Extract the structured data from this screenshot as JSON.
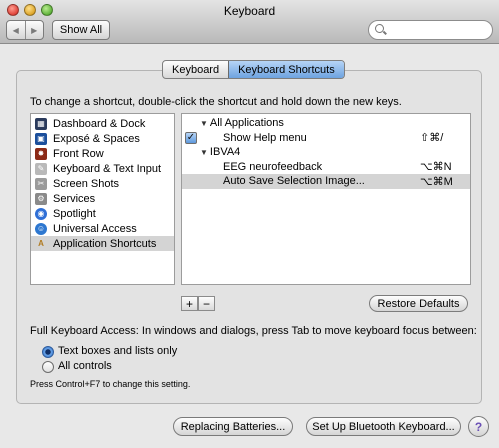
{
  "window": {
    "title": "Keyboard"
  },
  "toolbar": {
    "back_glyph": "◀",
    "forward_glyph": "▶",
    "show_all": "Show All",
    "search_placeholder": ""
  },
  "tabs": [
    {
      "label": "Keyboard",
      "selected": false
    },
    {
      "label": "Keyboard Shortcuts",
      "selected": true
    }
  ],
  "instructions": "To change a shortcut, double-click the shortcut and hold down the new keys.",
  "categories": [
    {
      "label": "Dashboard & Dock",
      "icon": "dashboard-dock-icon",
      "color": "#2a3a5c",
      "glyph": "▦"
    },
    {
      "label": "Exposé & Spaces",
      "icon": "expose-spaces-icon",
      "color": "#1b4f9c",
      "glyph": "▣"
    },
    {
      "label": "Front Row",
      "icon": "front-row-icon",
      "color": "#8c2a17",
      "glyph": "✸"
    },
    {
      "label": "Keyboard & Text Input",
      "icon": "keyboard-text-input-icon",
      "color": "#b9b9b9",
      "glyph": "✎"
    },
    {
      "label": "Screen Shots",
      "icon": "screen-shots-icon",
      "color": "#9b9b9b",
      "glyph": "✂"
    },
    {
      "label": "Services",
      "icon": "services-icon",
      "color": "#8a8a8a",
      "glyph": "⚙"
    },
    {
      "label": "Spotlight",
      "icon": "spotlight-icon",
      "color": "#2f6fd6",
      "glyph": "◉"
    },
    {
      "label": "Universal Access",
      "icon": "universal-access-icon",
      "color": "#2d77d0",
      "glyph": "☺"
    },
    {
      "label": "Application Shortcuts",
      "icon": "application-shortcuts-icon",
      "color": "#d7a54a",
      "glyph": "A"
    }
  ],
  "selected_category": "Application Shortcuts",
  "shortcuts": {
    "group1": {
      "title": "All Applications",
      "triangle": "▼"
    },
    "item1": {
      "name": "Show Help menu",
      "key": "⇧⌘/",
      "checked": true,
      "check_glyph": "✓"
    },
    "group2": {
      "title": "IBVA4",
      "triangle": "▼"
    },
    "item2": {
      "name": "EEG neurofeedback",
      "key": "⌥⌘N"
    },
    "item3": {
      "name": "Auto Save Selection Image...",
      "key": "⌥⌘M",
      "selected": true
    }
  },
  "controls": {
    "add": "+",
    "remove": "−",
    "restore_defaults": "Restore Defaults"
  },
  "full_keyboard_access": {
    "label": "Full Keyboard Access: In windows and dialogs, press Tab to move keyboard focus between:",
    "options": [
      {
        "label": "Text boxes and lists only",
        "selected": true
      },
      {
        "label": "All controls",
        "selected": false
      }
    ],
    "hint": "Press Control+F7 to change this setting."
  },
  "bottom": {
    "replacing_batteries": "Replacing Batteries...",
    "setup_bluetooth": "Set Up Bluetooth Keyboard...",
    "help": "?"
  }
}
